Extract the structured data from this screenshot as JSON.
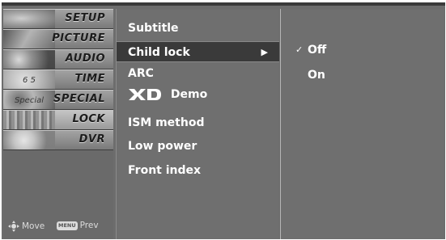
{
  "menu": {
    "items": [
      {
        "label": "SETUP",
        "icon": "setup-photo-icon"
      },
      {
        "label": "PICTURE",
        "icon": "picture-photo-icon"
      },
      {
        "label": "AUDIO",
        "icon": "audio-photo-icon"
      },
      {
        "label": "TIME",
        "icon": "clock-photo-icon",
        "thumb_text": "6  5"
      },
      {
        "label": "SPECIAL",
        "icon": "special-photo-icon",
        "thumb_text": "Special"
      },
      {
        "label": "LOCK",
        "icon": "lock-photo-icon"
      },
      {
        "label": "DVR",
        "icon": "disc-photo-icon"
      }
    ],
    "active_index": 5
  },
  "hints": {
    "move_label": "Move",
    "menu_key": "MENU",
    "prev_label": "Prev"
  },
  "submenu": {
    "items": [
      {
        "label": "Subtitle"
      },
      {
        "label": "Child lock",
        "arrow": "▶"
      },
      {
        "label": "ARC"
      },
      {
        "label": "Demo",
        "logo": "XD"
      },
      {
        "label": "ISM method"
      },
      {
        "label": "Low power"
      },
      {
        "label": "Front index"
      }
    ],
    "selected_index": 1
  },
  "options": {
    "items": [
      {
        "label": "Off",
        "checked": true,
        "check_mark": "✓"
      },
      {
        "label": "On",
        "checked": false
      }
    ]
  },
  "colors": {
    "panel_bg": "#6f6f6f",
    "selected_bg": "#3a3a3a",
    "text": "#ffffff",
    "menu_label": "#1c1c1c"
  }
}
